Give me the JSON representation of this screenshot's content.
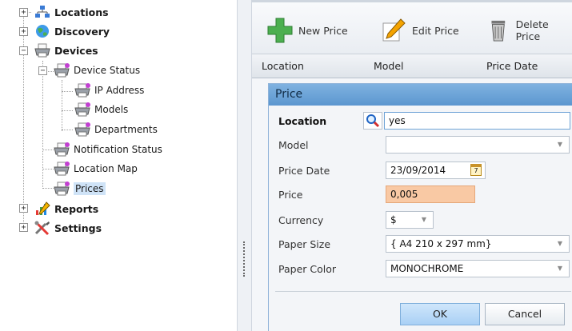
{
  "tree": {
    "items": [
      {
        "label": "Locations",
        "bold": true
      },
      {
        "label": "Discovery",
        "bold": true
      },
      {
        "label": "Devices",
        "bold": true
      },
      {
        "label": "Device Status"
      },
      {
        "label": "IP Address"
      },
      {
        "label": "Models"
      },
      {
        "label": "Departments"
      },
      {
        "label": "Notification Status"
      },
      {
        "label": "Location Map"
      },
      {
        "label": "Prices",
        "selected": true
      },
      {
        "label": "Reports",
        "bold": true
      },
      {
        "label": "Settings",
        "bold": true
      }
    ],
    "expand_plus": "+",
    "expand_minus": "−"
  },
  "toolbar": {
    "new_label": "New Price",
    "edit_label": "Edit Price",
    "delete_label": "Delete Price"
  },
  "grid": {
    "columns": [
      "Location",
      "Model",
      "Price Date"
    ]
  },
  "dialog": {
    "title": "Price",
    "fields": {
      "location": {
        "label": "Location",
        "value": "yes"
      },
      "model": {
        "label": "Model",
        "value": ""
      },
      "price_date": {
        "label": "Price Date",
        "value": "23/09/2014"
      },
      "price": {
        "label": "Price",
        "value": "0,005"
      },
      "currency": {
        "label": "Currency",
        "value": "$"
      },
      "paper_size": {
        "label": "Paper Size",
        "value": "{ A4 210 x 297 mm}"
      },
      "paper_color": {
        "label": "Paper Color",
        "value": "MONOCHROME"
      }
    },
    "ok_label": "OK",
    "cancel_label": "Cancel",
    "calendar_day": "7"
  },
  "colors": {
    "title_bar": "#5b96cf",
    "price_highlight": "#f9c9a4",
    "selected_row": "#cfe3f7"
  }
}
